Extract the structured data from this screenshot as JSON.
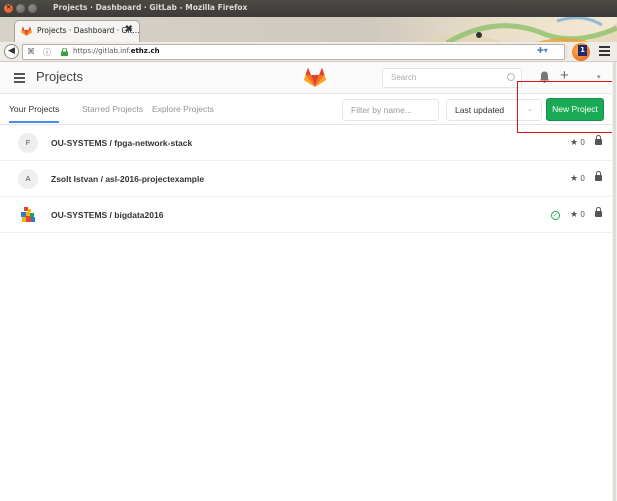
{
  "window": {
    "title": "Projects · Dashboard · GitLab - Mozilla Firefox"
  },
  "browser": {
    "tab_title": "Projects · Dashboard · Git...",
    "tab_close": "✖",
    "url_prefix": "https://gitlab.inf.",
    "url_domain": "ethz.ch",
    "extension_badge": "1"
  },
  "header": {
    "title": "Projects",
    "search_placeholder": "Search",
    "plus_label": "+",
    "caret_label": "▾"
  },
  "tabs": [
    {
      "label": "Your Projects",
      "active": true
    },
    {
      "label": "Starred Projects",
      "active": false
    },
    {
      "label": "Explore Projects",
      "active": false
    }
  ],
  "filter": {
    "placeholder": "Filter by name...",
    "sort_value": "Last updated",
    "sort_caret": "⌄"
  },
  "new_project_label": "New Project",
  "projects": [
    {
      "avatar": "F",
      "name": "OU-SYSTEMS / fpga-network-stack",
      "stars": "0",
      "ci": false
    },
    {
      "avatar": "A",
      "name": "Zsolt Istvan / asl-2016-projectexample",
      "stars": "0",
      "ci": false
    },
    {
      "avatar": "",
      "name": "OU-SYSTEMS / bigdata2016",
      "stars": "0",
      "ci": true
    }
  ],
  "colors": {
    "accent_green": "#1aaa55",
    "tab_underline": "#4a8bee",
    "gitlab_orange": "#fc6d26"
  },
  "icons": {
    "star": "★",
    "check": "✓"
  }
}
